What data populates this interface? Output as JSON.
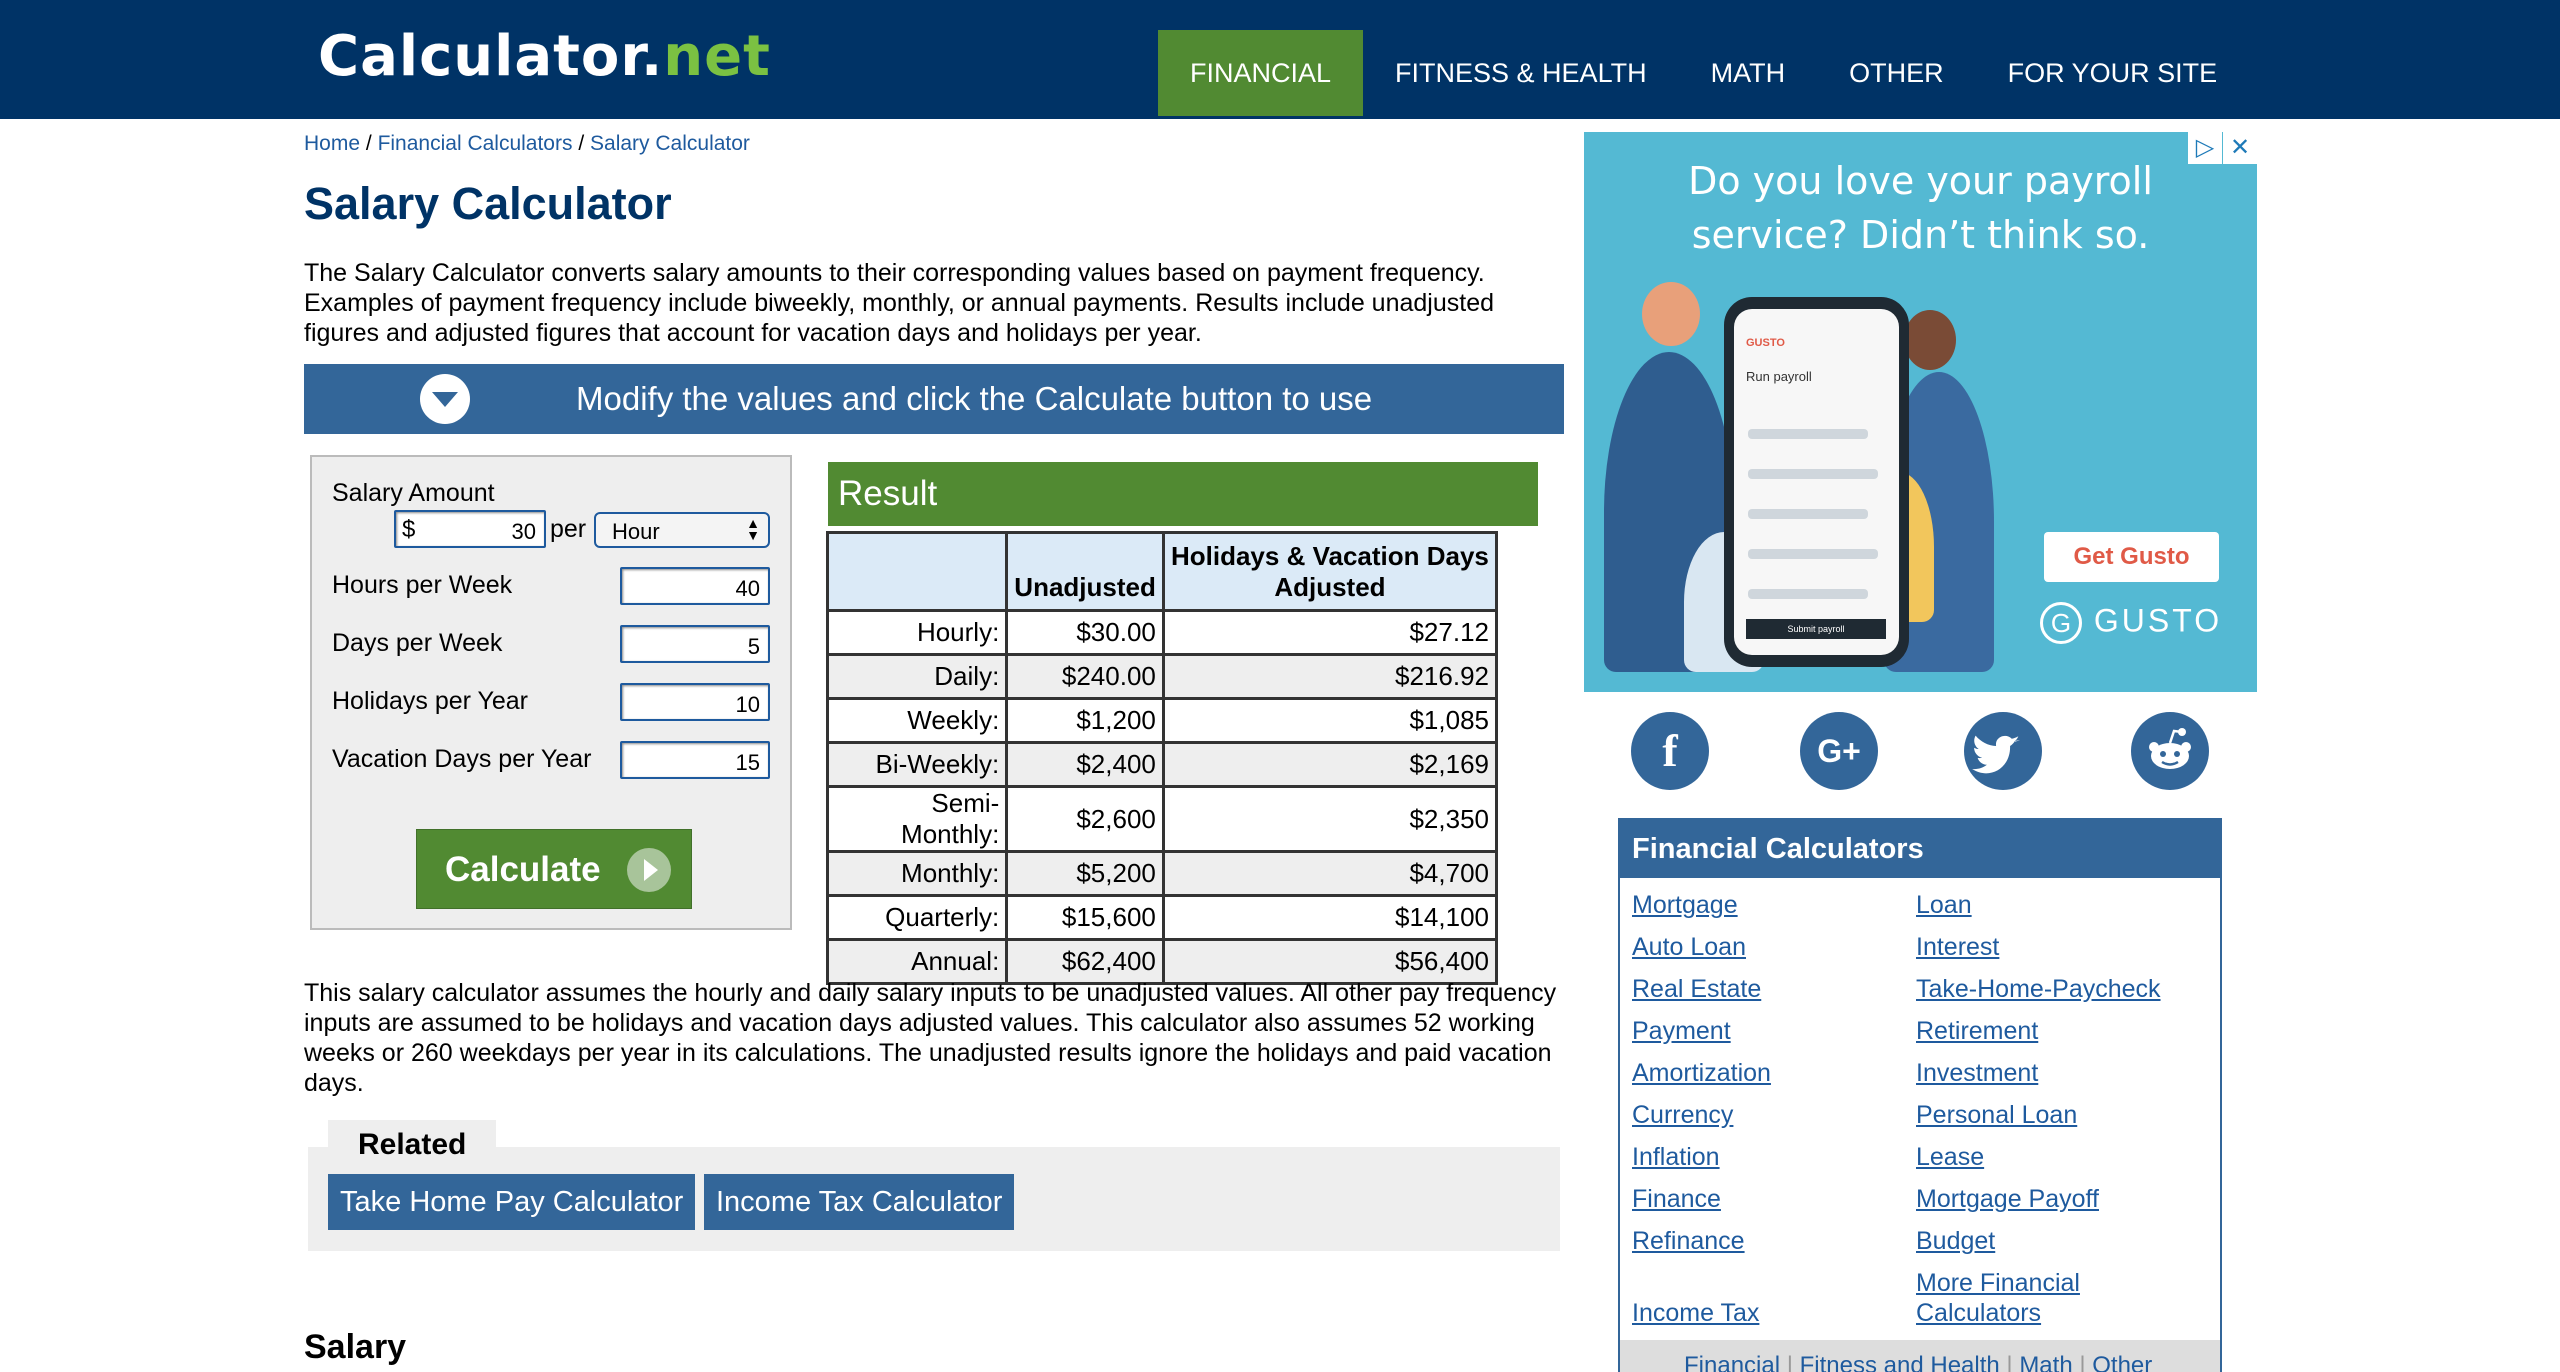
{
  "header": {
    "logo_main": "Calculator.",
    "logo_tld": "net",
    "nav": [
      "FINANCIAL",
      "FITNESS & HEALTH",
      "MATH",
      "OTHER",
      "FOR YOUR SITE"
    ]
  },
  "breadcrumb": {
    "items": [
      "Home",
      "Financial Calculators",
      "Salary Calculator"
    ],
    "separator": "/"
  },
  "page": {
    "title": "Salary Calculator",
    "intro": "The Salary Calculator converts salary amounts to their corresponding values based on payment frequency. Examples of payment frequency include biweekly, monthly, or annual payments. Results include unadjusted figures and adjusted figures that account for vacation days and holidays per year.",
    "banner": "Modify the values and click the Calculate button to use",
    "note": "This salary calculator assumes the hourly and daily salary inputs to be unadjusted values. All other pay frequency inputs are assumed to be holidays and vacation days adjusted values. This calculator also assumes 52 working weeks or 260 weekdays per year in its calculations. The unadjusted results ignore the holidays and paid vacation days."
  },
  "form": {
    "salary_label": "Salary Amount",
    "currency_symbol": "$",
    "salary_value": "30",
    "per_label": "per",
    "period_selected": "Hour",
    "hours_label": "Hours per Week",
    "hours_value": "40",
    "days_label": "Days per Week",
    "days_value": "5",
    "holidays_label": "Holidays per Year",
    "holidays_value": "10",
    "vacation_label": "Vacation Days per Year",
    "vacation_value": "15",
    "calculate_label": "Calculate"
  },
  "result": {
    "heading": "Result",
    "col_unadjusted": "Unadjusted",
    "col_adjusted_1": "Holidays & Vacation Days",
    "col_adjusted_2": "Adjusted",
    "rows": [
      {
        "label": "Hourly:",
        "unadjusted": "$30.00",
        "adjusted": "$27.12"
      },
      {
        "label": "Daily:",
        "unadjusted": "$240.00",
        "adjusted": "$216.92"
      },
      {
        "label": "Weekly:",
        "unadjusted": "$1,200",
        "adjusted": "$1,085"
      },
      {
        "label": "Bi-Weekly:",
        "unadjusted": "$2,400",
        "adjusted": "$2,169"
      },
      {
        "label": "Semi-Monthly:",
        "unadjusted": "$2,600",
        "adjusted": "$2,350"
      },
      {
        "label": "Monthly:",
        "unadjusted": "$5,200",
        "adjusted": "$4,700"
      },
      {
        "label": "Quarterly:",
        "unadjusted": "$15,600",
        "adjusted": "$14,100"
      },
      {
        "label": "Annual:",
        "unadjusted": "$62,400",
        "adjusted": "$56,400"
      }
    ]
  },
  "related": {
    "heading": "Related",
    "links": [
      "Take Home Pay Calculator",
      "Income Tax Calculator"
    ]
  },
  "section_heading": "Salary",
  "ad": {
    "headline_1": "Do you love your payroll",
    "headline_2": "service? Didn’t think so.",
    "cta": "Get Gusto",
    "brand": "GUSTO",
    "phone_brand": "GUSTO",
    "phone_title": "Run payroll",
    "phone_button": "Submit payroll",
    "colors": {
      "background": "#54b9d3",
      "cta_text": "#e05a47"
    }
  },
  "social": [
    "facebook-icon",
    "google-plus-icon",
    "twitter-icon",
    "reddit-icon"
  ],
  "sidebar": {
    "heading": "Financial Calculators",
    "left_links": [
      "Mortgage",
      "Auto Loan",
      "Real Estate",
      "Payment",
      "Amortization",
      "Currency",
      "Inflation",
      "Finance",
      "Refinance",
      "Income Tax"
    ],
    "right_links": [
      "Loan",
      "Interest",
      "Take-Home-Paycheck",
      "Retirement",
      "Investment",
      "Personal Loan",
      "Lease",
      "Mortgage Payoff",
      "Budget",
      "More Financial Calculators"
    ],
    "footer_links": [
      "Financial",
      "Fitness and Health",
      "Math",
      "Other"
    ]
  },
  "colors": {
    "header_bg": "#003366",
    "accent_green": "#518a32",
    "accent_blue": "#336699",
    "logo_green": "#7bc142"
  }
}
